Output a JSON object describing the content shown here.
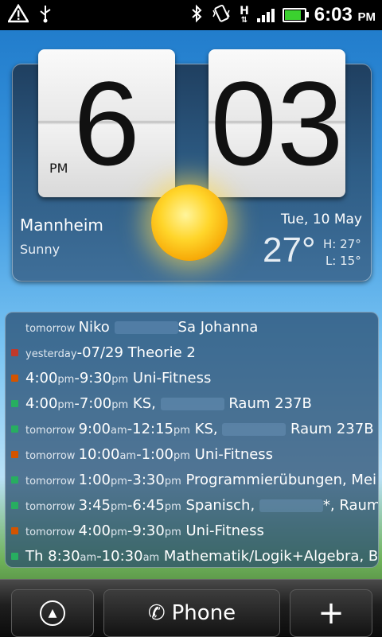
{
  "status_bar": {
    "icons": [
      "warning-icon",
      "usb-icon",
      "bluetooth-icon",
      "vibrate-icon",
      "hspa-icon",
      "signal-icon",
      "battery-icon"
    ],
    "hspa_label": "H",
    "time": "6:03",
    "ampm": "PM"
  },
  "clock_widget": {
    "hour": "6",
    "minute": "03",
    "ampm": "PM",
    "city": "Mannheim",
    "condition": "Sunny",
    "date": "Tue, 10 May",
    "temperature": "27°",
    "high": "H: 27°",
    "low": "L: 15°",
    "weather_icon": "sun-icon"
  },
  "agenda": {
    "events": [
      {
        "color": "none",
        "parts": [
          {
            "t": "tomorrow ",
            "s": true
          },
          {
            "t": "Niko "
          },
          {
            "t": "",
            "blur": true
          },
          {
            "t": "Sa Johanna"
          }
        ]
      },
      {
        "color": "#c0392b",
        "parts": [
          {
            "t": "yesterday",
            "s": true
          },
          {
            "t": "-07/29 Theorie 2"
          }
        ]
      },
      {
        "color": "#d35400",
        "parts": [
          {
            "t": "4:00"
          },
          {
            "t": "pm",
            "s": true
          },
          {
            "t": "-9:30"
          },
          {
            "t": "pm",
            "s": true
          },
          {
            "t": " Uni-Fitness"
          }
        ]
      },
      {
        "color": "#27ae60",
        "parts": [
          {
            "t": "4:00"
          },
          {
            "t": "pm",
            "s": true
          },
          {
            "t": "-7:00"
          },
          {
            "t": "pm",
            "s": true
          },
          {
            "t": " KS, "
          },
          {
            "t": "",
            "blur": true
          },
          {
            "t": " Raum 237B"
          }
        ]
      },
      {
        "color": "#27ae60",
        "parts": [
          {
            "t": "tomorrow ",
            "s": true
          },
          {
            "t": "9:00"
          },
          {
            "t": "am",
            "s": true
          },
          {
            "t": "-12:15"
          },
          {
            "t": "pm",
            "s": true
          },
          {
            "t": " KS, "
          },
          {
            "t": "",
            "blur": true
          },
          {
            "t": " Raum 237B"
          }
        ]
      },
      {
        "color": "#d35400",
        "parts": [
          {
            "t": "tomorrow ",
            "s": true
          },
          {
            "t": "10:00"
          },
          {
            "t": "am",
            "s": true
          },
          {
            "t": "-1:00"
          },
          {
            "t": "pm",
            "s": true
          },
          {
            "t": " Uni-Fitness"
          }
        ]
      },
      {
        "color": "#27ae60",
        "parts": [
          {
            "t": "tomorrow ",
            "s": true
          },
          {
            "t": "1:00"
          },
          {
            "t": "pm",
            "s": true
          },
          {
            "t": "-3:30"
          },
          {
            "t": "pm",
            "s": true
          },
          {
            "t": " Programmierübungen, Mei"
          }
        ]
      },
      {
        "color": "#27ae60",
        "parts": [
          {
            "t": "tomorrow ",
            "s": true
          },
          {
            "t": "3:45"
          },
          {
            "t": "pm",
            "s": true
          },
          {
            "t": "-6:45"
          },
          {
            "t": "pm",
            "s": true
          },
          {
            "t": " Spanisch, "
          },
          {
            "t": "",
            "blur": true
          },
          {
            "t": "*, Raum"
          }
        ]
      },
      {
        "color": "#d35400",
        "parts": [
          {
            "t": "tomorrow ",
            "s": true
          },
          {
            "t": "4:00"
          },
          {
            "t": "pm",
            "s": true
          },
          {
            "t": "-9:30"
          },
          {
            "t": "pm",
            "s": true
          },
          {
            "t": " Uni-Fitness"
          }
        ]
      },
      {
        "color": "#27ae60",
        "parts": [
          {
            "t": "Th 8:30"
          },
          {
            "t": "am",
            "s": true
          },
          {
            "t": "-10:30"
          },
          {
            "t": "am",
            "s": true
          },
          {
            "t": " Mathematik/Logik+Algebra, Be"
          }
        ]
      }
    ]
  },
  "dock": {
    "phone_label": "Phone",
    "add_label": "+",
    "up_icon": "arrow-up-circle-icon",
    "phone_icon": "phone-handset-icon"
  }
}
